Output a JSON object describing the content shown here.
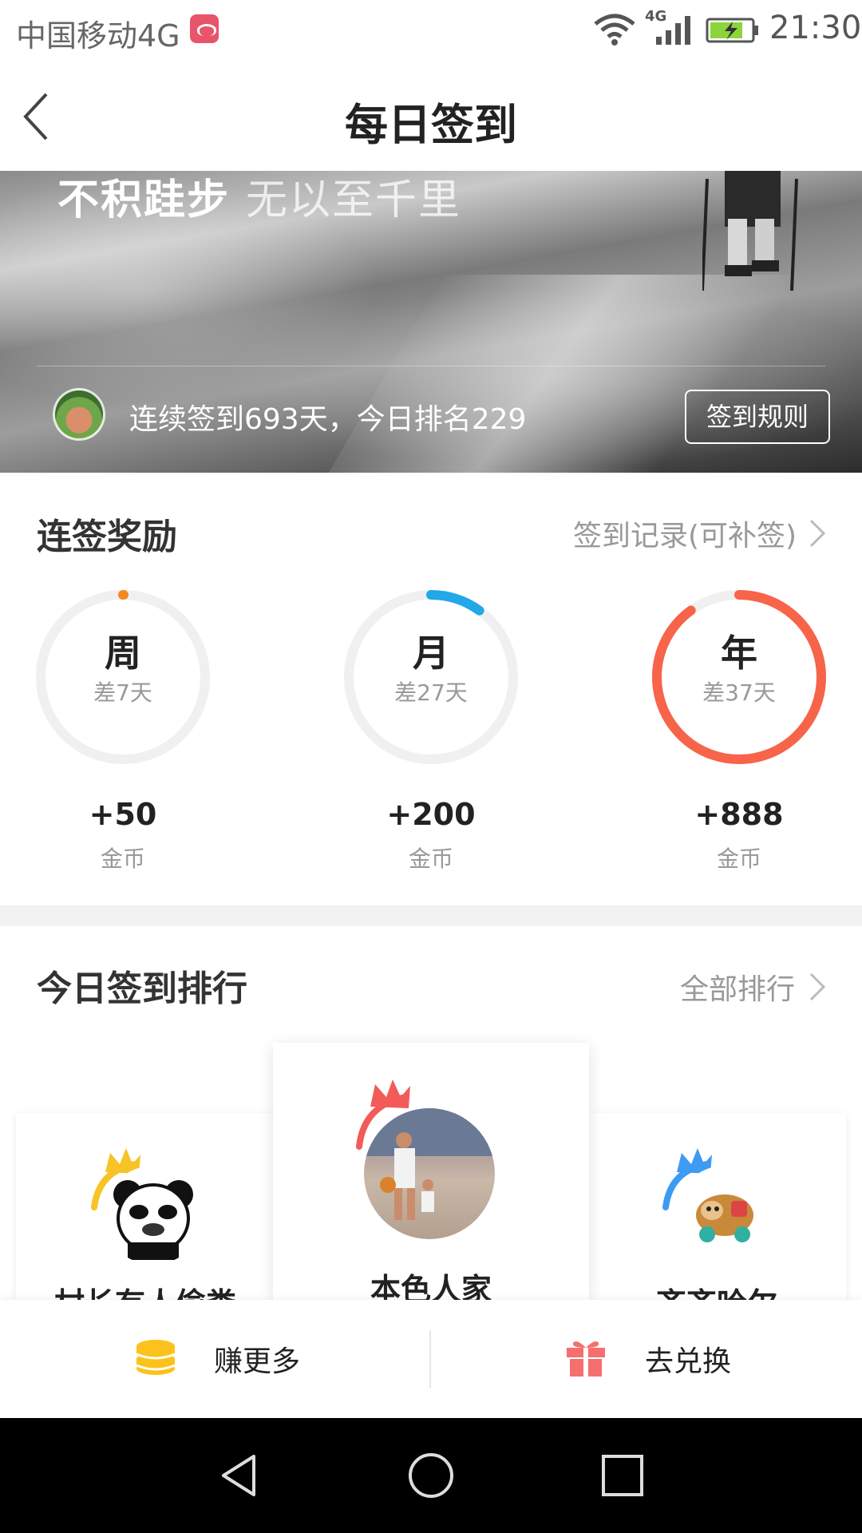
{
  "status_bar": {
    "carrier": "中国移动4G",
    "network_label": "4G",
    "time": "21:30"
  },
  "nav": {
    "title": "每日签到"
  },
  "banner": {
    "motto_bold": "不积跬步",
    "motto_light": "无以至千里",
    "streak_text": "连续签到693天，今日排名229",
    "rules_button": "签到规则"
  },
  "rewards": {
    "title": "连签奖励",
    "record_link": "签到记录(可补签)",
    "items": [
      {
        "label": "周",
        "remaining": "差7天",
        "amount": "+50",
        "unit": "金币",
        "progress": 0.0,
        "color": "#f5891f"
      },
      {
        "label": "月",
        "remaining": "差27天",
        "amount": "+200",
        "unit": "金币",
        "progress": 0.1,
        "color": "#22a7e8"
      },
      {
        "label": "年",
        "remaining": "差37天",
        "amount": "+888",
        "unit": "金币",
        "progress": 0.9,
        "color": "#f76449"
      }
    ],
    "track_color": "#f0f0f0"
  },
  "ranking": {
    "title": "今日签到排行",
    "all_link": "全部排行",
    "entries": [
      {
        "place": 2,
        "name": "村长有人偷粪",
        "crown_color": "#f7c325"
      },
      {
        "place": 1,
        "name": "本色人家",
        "crown_color": "#f25b58"
      },
      {
        "place": 3,
        "name": "齐齐哈尔",
        "crown_color": "#3d9bf2"
      }
    ]
  },
  "actions": {
    "earn_more": "赚更多",
    "redeem": "去兑换",
    "coin_color": "#fcc21b",
    "gift_color": "#f56f6f"
  }
}
